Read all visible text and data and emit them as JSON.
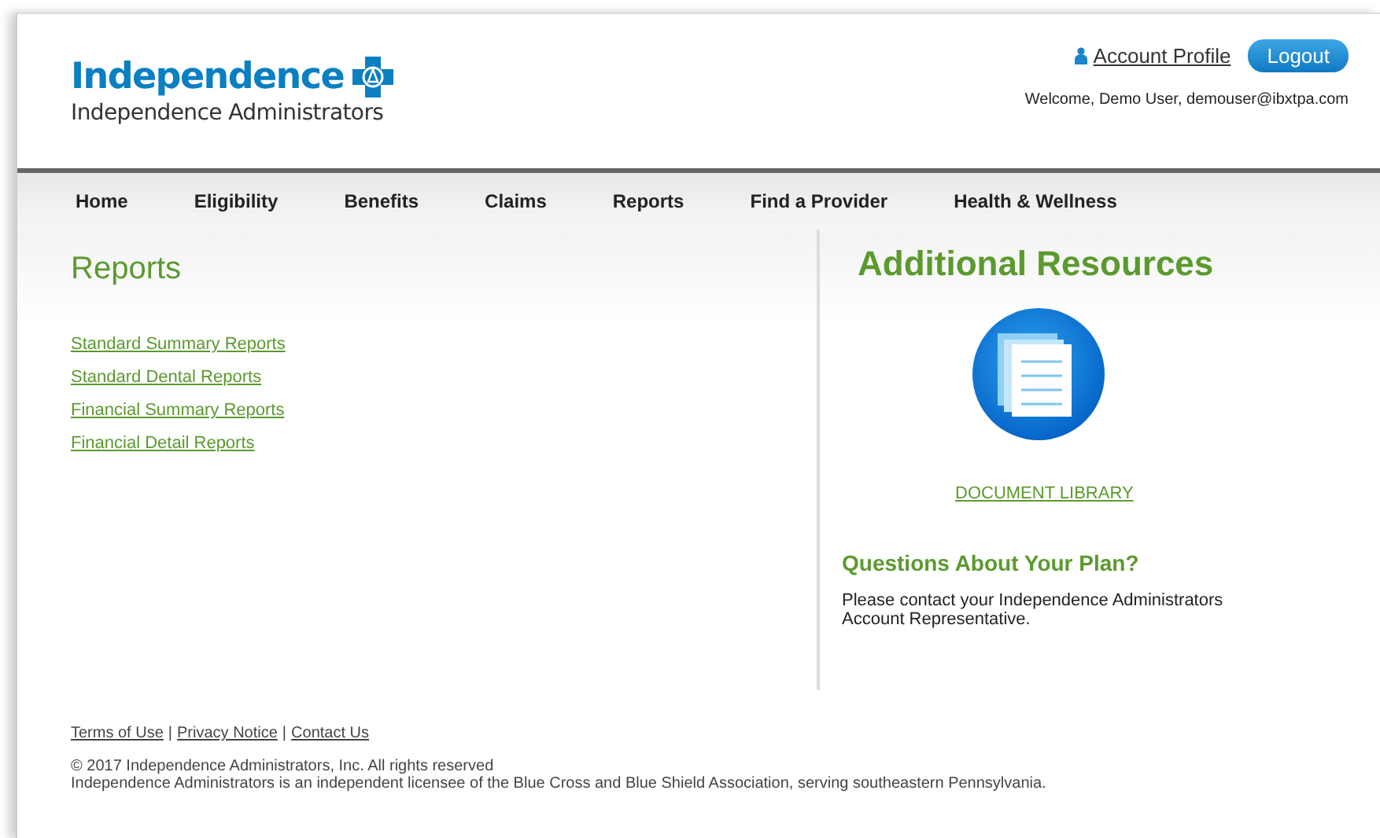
{
  "header": {
    "logo_title": "Independence",
    "logo_subtitle": "Independence Administrators",
    "account_link": "Account Profile",
    "logout_button": "Logout",
    "welcome": "Welcome, Demo User, demouser@ibxtpa.com"
  },
  "nav": [
    "Home",
    "Eligibility",
    "Benefits",
    "Claims",
    "Reports",
    "Find a Provider",
    "Health & Wellness"
  ],
  "reports": {
    "title": "Reports",
    "links": [
      "Standard Summary Reports",
      "Standard Dental Reports",
      "Financial Summary Reports",
      "Financial Detail Reports"
    ]
  },
  "resources": {
    "title": "Additional Resources",
    "document_link": "DOCUMENT LIBRARY",
    "questions_title": "Questions About Your Plan?",
    "questions_text": "Please contact your Independence Administrators Account Representative."
  },
  "footer": {
    "links": [
      "Terms of Use",
      "Privacy Notice",
      "Contact Us"
    ],
    "separators": [
      "|",
      "|"
    ],
    "copyright": "© 2017 Independence Administrators, Inc. All rights reserved",
    "license": "Independence Administrators is an independent licensee of the Blue Cross and Blue Shield Association, serving southeastern Pennsylvania."
  }
}
